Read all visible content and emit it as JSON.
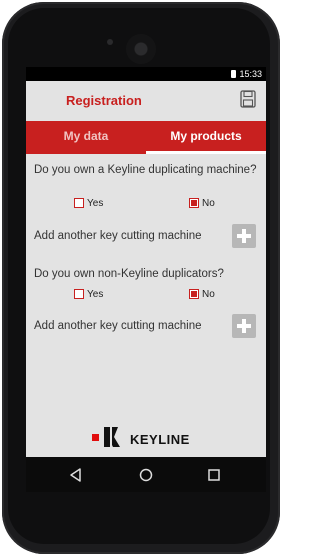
{
  "status_bar": {
    "time": "15:33"
  },
  "header": {
    "title": "Registration",
    "save_icon": "save-icon"
  },
  "tabs": [
    {
      "label": "My data",
      "active": false
    },
    {
      "label": "My products",
      "active": true
    }
  ],
  "questions": [
    {
      "text": "Do you own a Keyline duplicating machine?",
      "options": [
        {
          "label": "Yes",
          "checked": false
        },
        {
          "label": "No",
          "checked": true
        }
      ],
      "add_label": "Add another key cutting machine"
    },
    {
      "text": "Do you own non-Keyline duplicators?",
      "options": [
        {
          "label": "Yes",
          "checked": false
        },
        {
          "label": "No",
          "checked": true
        }
      ],
      "add_label": "Add another key cutting machine"
    }
  ],
  "logo": {
    "brand": "KEYLINE"
  },
  "nav": {
    "back": "back-icon",
    "home": "home-icon",
    "recents": "recents-icon"
  },
  "colors": {
    "accent": "#c8201f",
    "background": "#e3e3e3",
    "add_button": "#b7b7b7"
  }
}
